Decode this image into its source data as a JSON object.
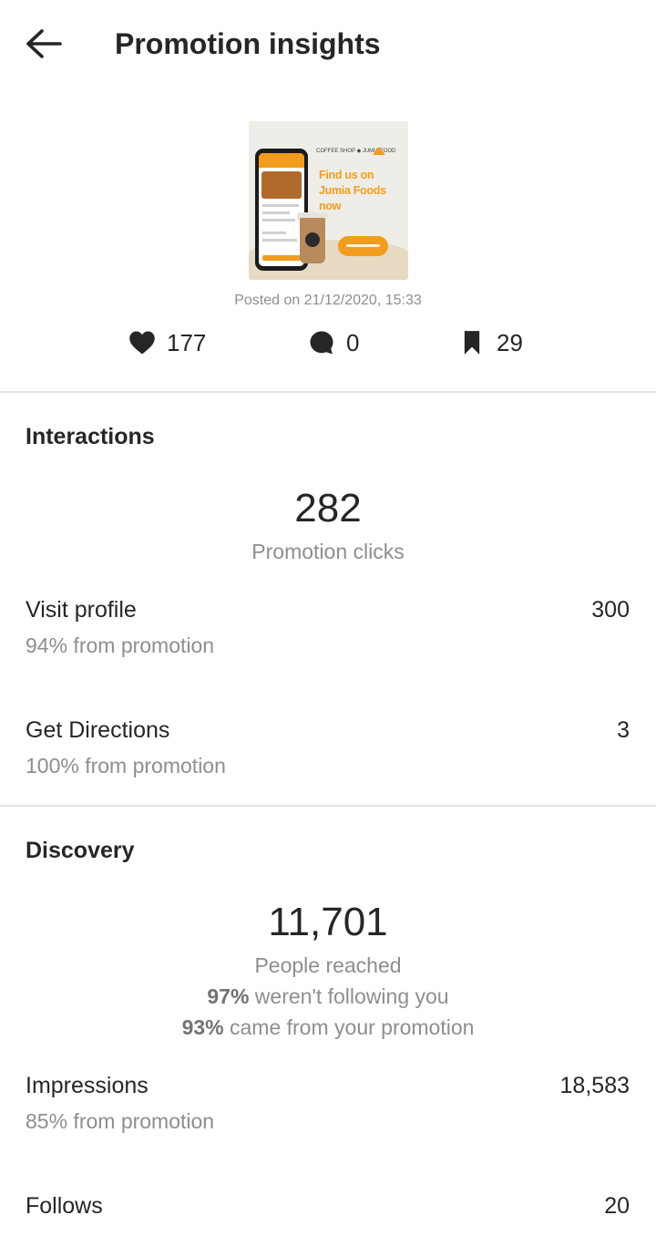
{
  "header": {
    "title": "Promotion insights",
    "back_icon": "arrow-left-icon"
  },
  "post": {
    "thumbnail": {
      "headline": "Find us on Jumia Foods now",
      "logos_text": "COFFEE SHOP ◆ JUMIA FOOD",
      "brand_color": "#f39c1e"
    },
    "posted_text": "Posted on 21/12/2020, 15:33",
    "likes": "177",
    "comments": "0",
    "saves": "29"
  },
  "interactions": {
    "title": "Interactions",
    "total": "282",
    "total_caption": "Promotion clicks",
    "rows": [
      {
        "label": "Visit profile",
        "sub": "94% from promotion",
        "value": "300"
      },
      {
        "label": "Get Directions",
        "sub": "100% from promotion",
        "value": "3"
      }
    ]
  },
  "discovery": {
    "title": "Discovery",
    "total": "11,701",
    "total_caption": "People reached",
    "not_following_pct": "97%",
    "not_following_text": " weren't following you",
    "from_promo_pct": "93%",
    "from_promo_text": " came from your promotion",
    "rows": [
      {
        "label": "Impressions",
        "sub": "85% from promotion",
        "value": "18,583"
      },
      {
        "label": "Follows",
        "value": "20"
      }
    ]
  },
  "colors": {
    "text": "#262626",
    "secondary_text": "#8e8e8e",
    "divider": "#e2e2e2",
    "accent": "#f39c1e"
  }
}
